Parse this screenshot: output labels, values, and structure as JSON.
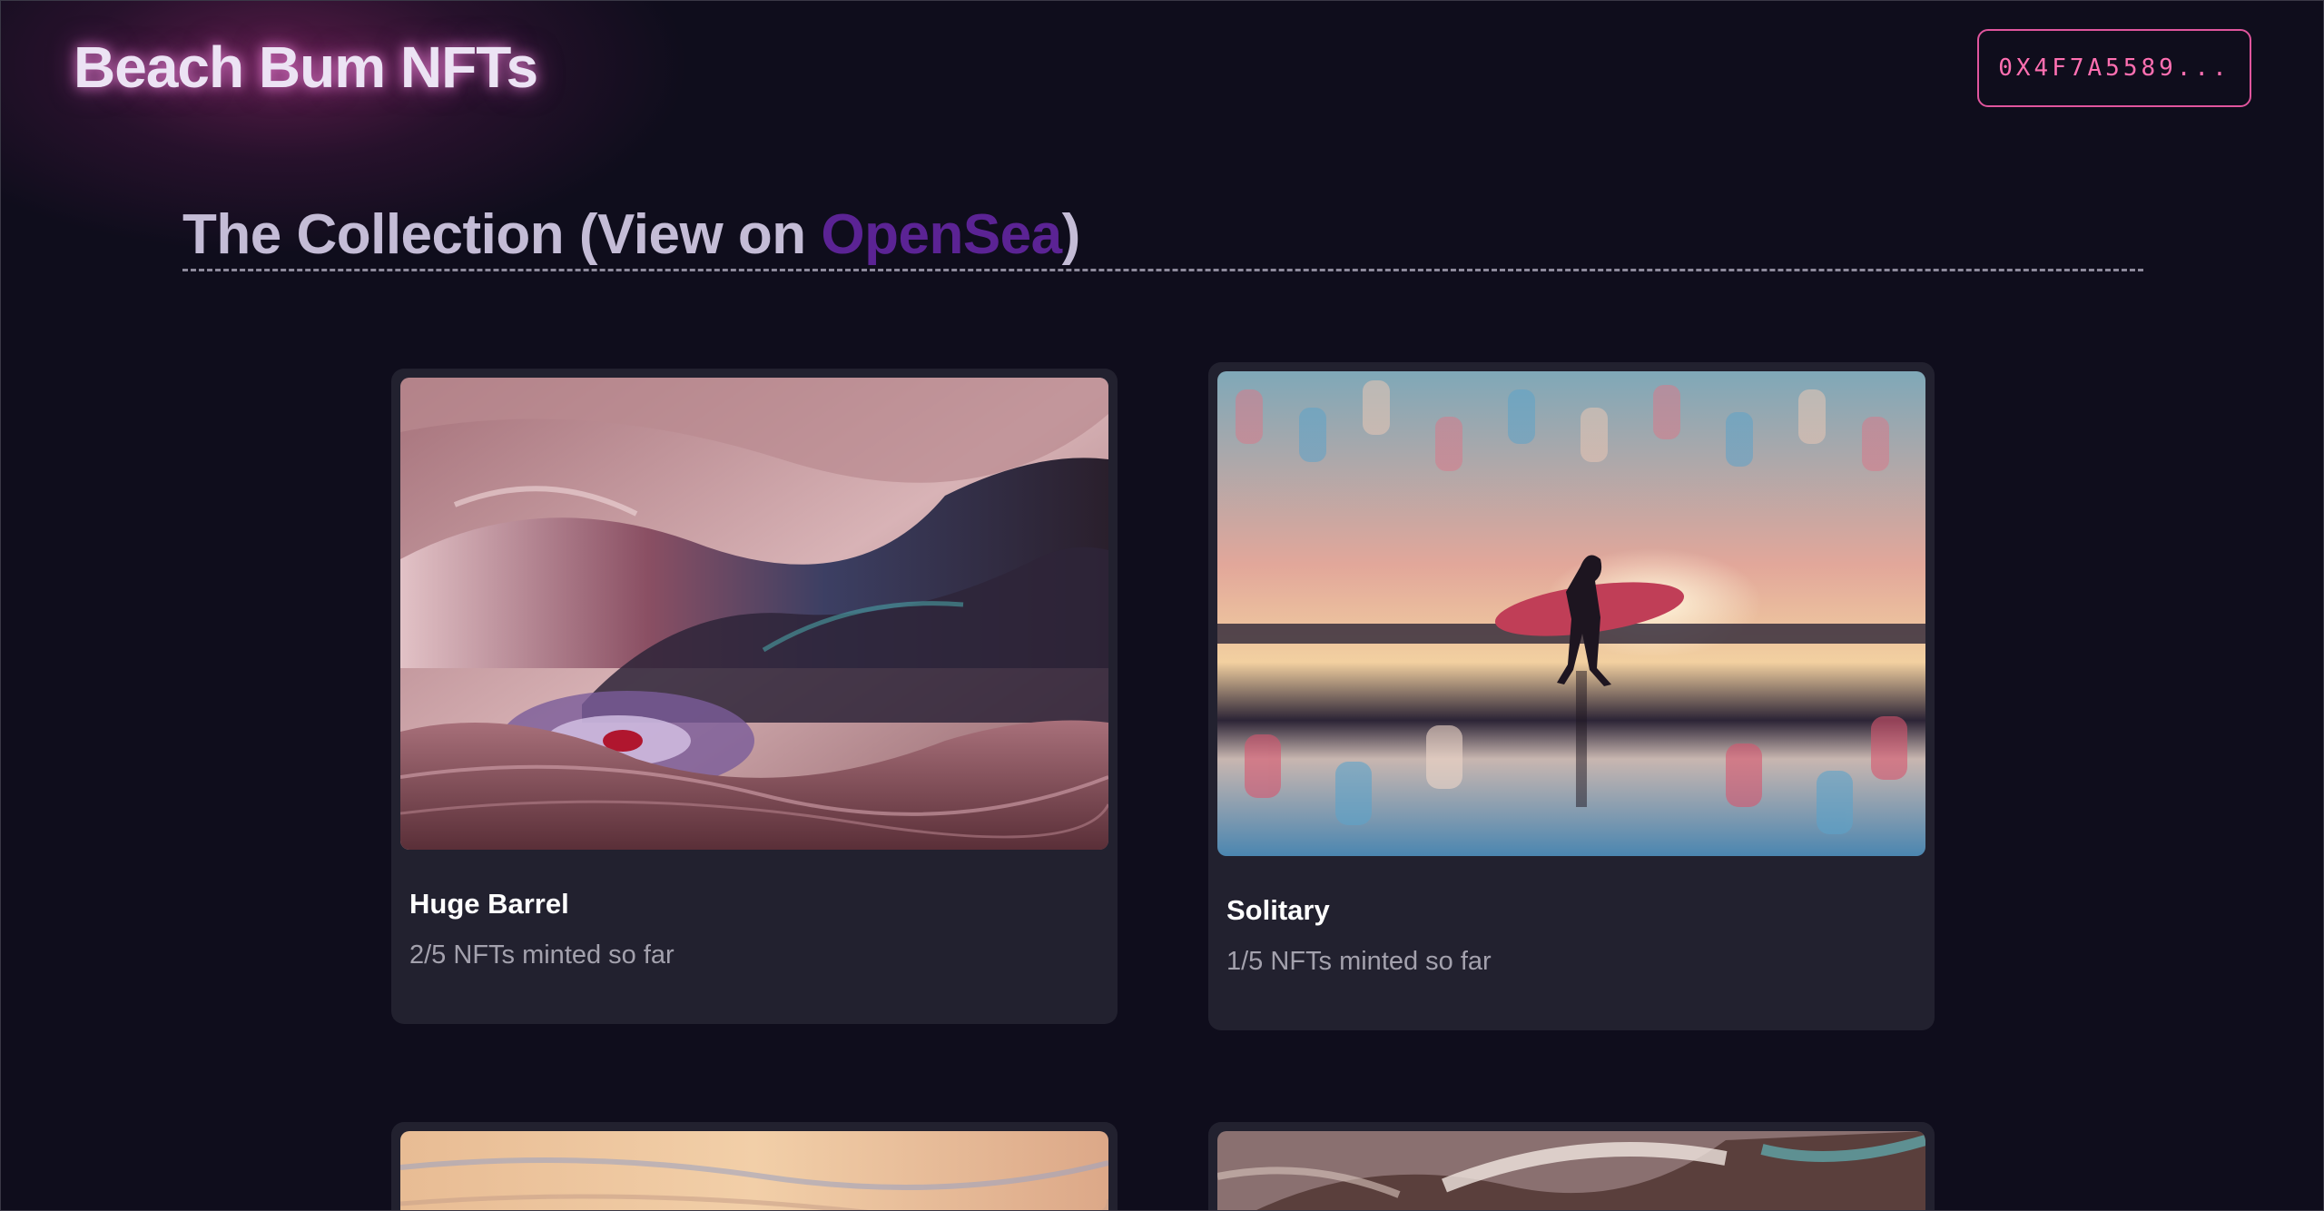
{
  "header": {
    "logo": "Beach Bum NFTs",
    "wallet_button": "0X4F7A5589..."
  },
  "collection": {
    "title_prefix": "The Collection (View on ",
    "title_link": "OpenSea",
    "title_suffix": ")"
  },
  "cards": [
    {
      "title": "Huge Barrel",
      "minted": "2/5 NFTs minted so far"
    },
    {
      "title": "Solitary",
      "minted": "1/5 NFTs minted so far"
    }
  ],
  "colors": {
    "background": "#0f0d1c",
    "card": "#22212f",
    "accent_pink": "#e0559d",
    "link_purple": "#5b2394"
  }
}
